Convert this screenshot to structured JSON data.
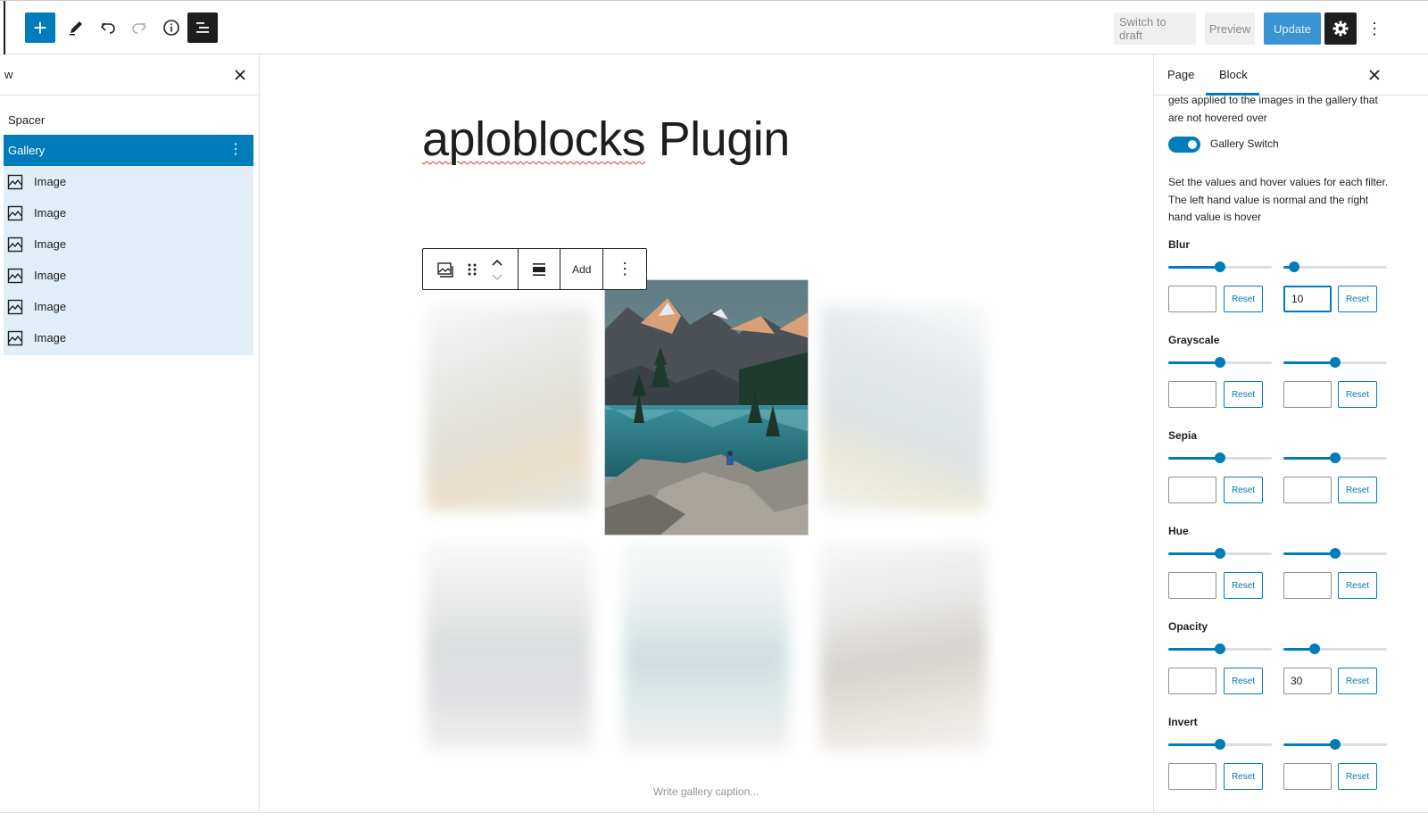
{
  "toolbar": {
    "add_label": "+",
    "switch_to_draft": "Switch to draft",
    "preview": "Preview",
    "update": "Update",
    "more": "⋮"
  },
  "listview": {
    "title": "w",
    "items": [
      {
        "label": "Spacer"
      },
      {
        "label": "Gallery"
      },
      {
        "label": "Image"
      },
      {
        "label": "Image"
      },
      {
        "label": "Image"
      },
      {
        "label": "Image"
      },
      {
        "label": "Image"
      },
      {
        "label": "Image"
      }
    ]
  },
  "editor": {
    "title_part1": "aploblocks",
    "title_part2": " Plugin",
    "block_toolbar_add": "Add",
    "caption_placeholder": "Write gallery caption..."
  },
  "sidebar": {
    "tabs": [
      {
        "label": "Page"
      },
      {
        "label": "Block"
      }
    ],
    "active_tab": "Block",
    "intro_text": "gets applied to the images in the gallery that are not hovered over",
    "toggle_label": "Gallery Switch",
    "toggle_on": true,
    "description": "Set the values and hover values for each filter. The left hand value is normal and the right hand value is hover",
    "reset_label": "Reset",
    "filters": [
      {
        "name": "Blur",
        "left_value": "",
        "right_value": "10",
        "left_level": 0.5,
        "right_level": 0.1
      },
      {
        "name": "Grayscale",
        "left_value": "",
        "right_value": "",
        "left_level": 0.5,
        "right_level": 0.5
      },
      {
        "name": "Sepia",
        "left_value": "",
        "right_value": "",
        "left_level": 0.5,
        "right_level": 0.5
      },
      {
        "name": "Hue",
        "left_value": "",
        "right_value": "",
        "left_level": 0.5,
        "right_level": 0.5
      },
      {
        "name": "Opacity",
        "left_value": "",
        "right_value": "30",
        "left_level": 0.5,
        "right_level": 0.3
      },
      {
        "name": "Invert",
        "left_value": "",
        "right_value": "",
        "left_level": 0.5,
        "right_level": 0.5
      }
    ]
  },
  "colors": {
    "accent": "#007cba",
    "selected_bg": "#e2eef7",
    "dark": "#1e1e1e"
  }
}
